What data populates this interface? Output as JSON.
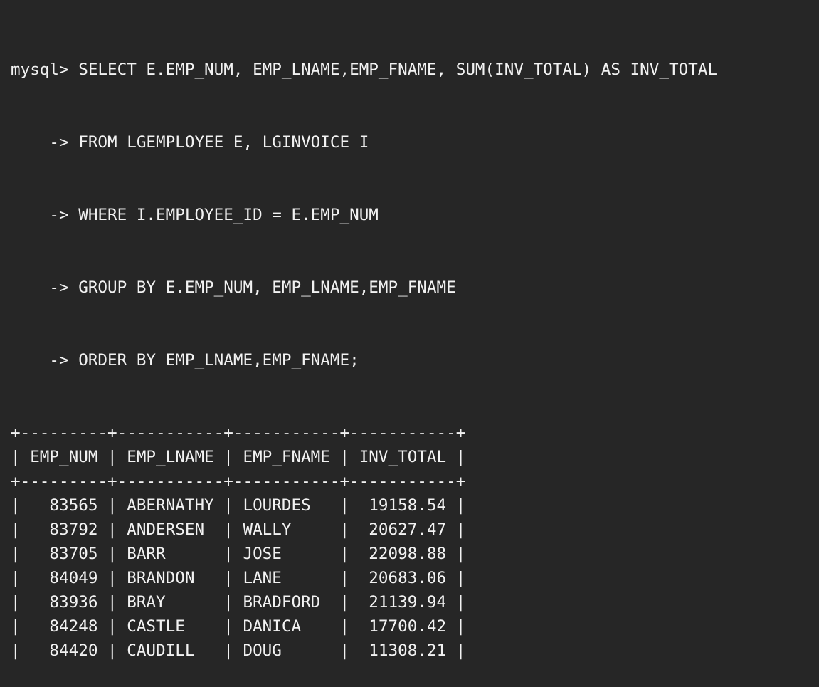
{
  "terminal": {
    "prompt": "mysql> ",
    "continuation": "    -> ",
    "query": [
      "SELECT E.EMP_NUM, EMP_LNAME,EMP_FNAME, SUM(INV_TOTAL) AS INV_TOTAL",
      "FROM LGEMPLOYEE E, LGINVOICE I",
      "WHERE I.EMPLOYEE_ID = E.EMP_NUM",
      "GROUP BY E.EMP_NUM, EMP_LNAME,EMP_FNAME",
      "ORDER BY EMP_LNAME,EMP_FNAME;"
    ],
    "table": {
      "columns": [
        "EMP_NUM",
        "EMP_LNAME",
        "EMP_FNAME",
        "INV_TOTAL"
      ],
      "rows": [
        [
          "83565",
          "ABERNATHY",
          "LOURDES",
          "19158.54"
        ],
        [
          "83792",
          "ANDERSEN",
          "WALLY",
          "20627.47"
        ],
        [
          "83705",
          "BARR",
          "JOSE",
          "22098.88"
        ],
        [
          "84049",
          "BRANDON",
          "LANE",
          "20683.06"
        ],
        [
          "83936",
          "BRAY",
          "BRADFORD",
          "21139.94"
        ],
        [
          "84248",
          "CASTLE",
          "DANICA",
          "17700.42"
        ],
        [
          "84420",
          "CAUDILL",
          "DOUG",
          "11308.21"
        ]
      ]
    }
  }
}
